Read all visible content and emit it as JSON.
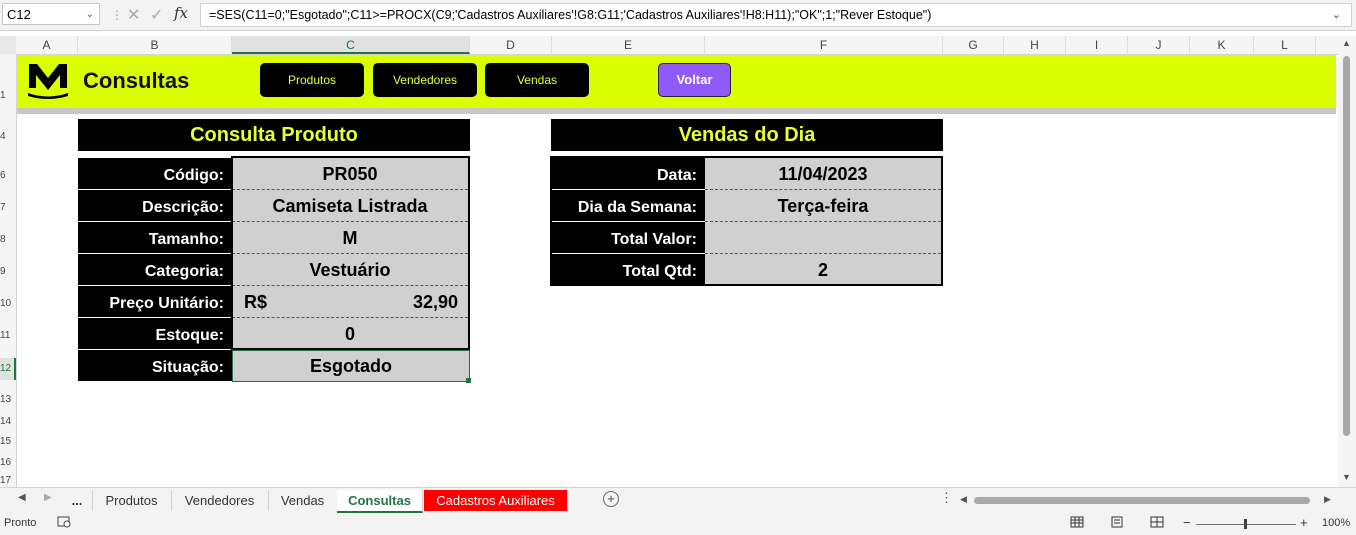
{
  "formula_bar": {
    "name_box": "C12",
    "fx": "fx",
    "formula": "=SES(C11=0;\"Esgotado\";C11>=PROCX(C9;'Cadastros Auxiliares'!G8:G11;'Cadastros Auxiliares'!H8:H11);\"OK\";1;\"Rever Estoque\")"
  },
  "columns": [
    "A",
    "B",
    "C",
    "D",
    "E",
    "F",
    "G",
    "H",
    "I",
    "J",
    "K",
    "L"
  ],
  "rows": [
    "1",
    "4",
    "6",
    "7",
    "8",
    "9",
    "10",
    "11",
    "12",
    "13",
    "14",
    "15",
    "16",
    "17"
  ],
  "banner": {
    "title": "Consultas",
    "nav": [
      "Produtos",
      "Vendedores",
      "Vendas"
    ],
    "back_label": "Voltar",
    "accent": "#d9ff00",
    "back_color": "#8f5af7"
  },
  "product_panel": {
    "title": "Consulta Produto",
    "fields": [
      {
        "label": "Código:",
        "value": "PR050"
      },
      {
        "label": "Descrição:",
        "value": "Camiseta Listrada"
      },
      {
        "label": "Tamanho:",
        "value": "M"
      },
      {
        "label": "Categoria:",
        "value": "Vestuário"
      },
      {
        "label": "Preço Unitário:",
        "currency": "R$",
        "value": "32,90"
      },
      {
        "label": "Estoque:",
        "value": "0"
      },
      {
        "label": "Situação:",
        "value": "Esgotado"
      }
    ]
  },
  "sales_panel": {
    "title": "Vendas do Dia",
    "fields": [
      {
        "label": "Data:",
        "value": "11/04/2023"
      },
      {
        "label": "Dia da Semana:",
        "value": "Terça-feira"
      },
      {
        "label": "Total Valor:",
        "value": ""
      },
      {
        "label": "Total Qtd:",
        "value": "2"
      }
    ]
  },
  "sheets": {
    "ellipsis": "...",
    "tabs": [
      "Produtos",
      "Vendedores",
      "Vendas",
      "Consultas",
      "Cadastros Auxiliares"
    ],
    "active": "Consultas"
  },
  "status": {
    "mode": "Pronto",
    "zoom": "100%"
  }
}
